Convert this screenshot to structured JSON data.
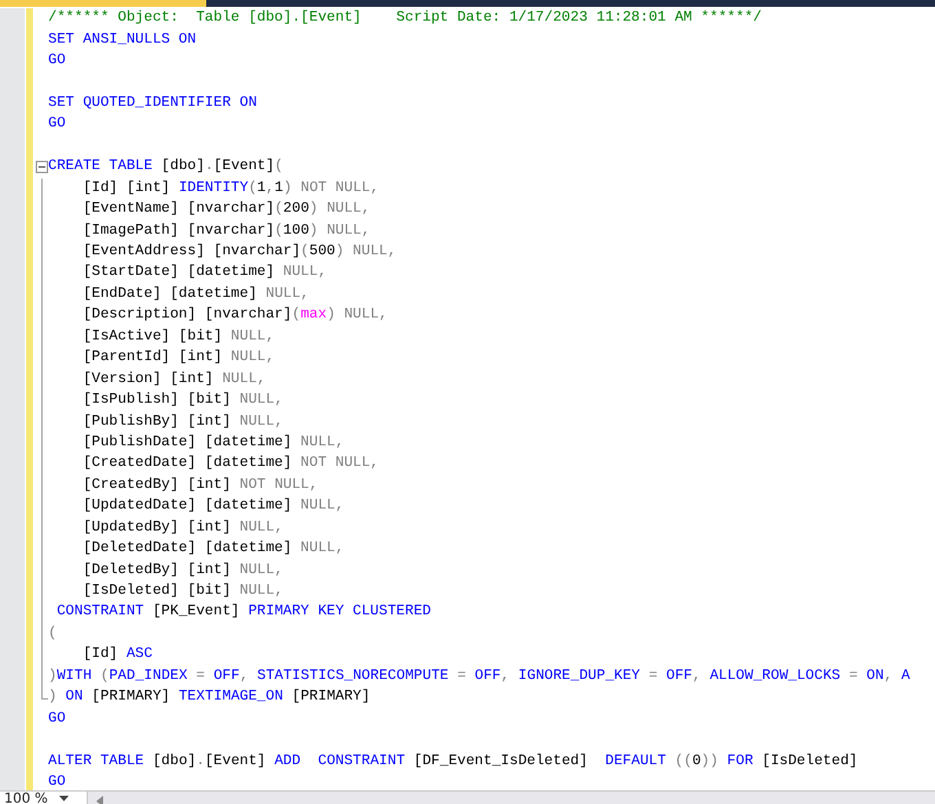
{
  "editor": {
    "lines": [
      {
        "kind": "code",
        "tokens": [
          {
            "kind": "comment",
            "text": "/****** Object:  Table [dbo].[Event]    Script Date: 1/17/2023 11:28:01 AM ******/"
          }
        ]
      },
      {
        "kind": "code",
        "tokens": [
          {
            "kind": "keyword",
            "text": "SET ANSI_NULLS ON"
          }
        ]
      },
      {
        "kind": "code",
        "tokens": [
          {
            "kind": "keyword",
            "text": "GO"
          }
        ]
      },
      {
        "kind": "blank"
      },
      {
        "kind": "code",
        "tokens": [
          {
            "kind": "keyword",
            "text": "SET QUOTED_IDENTIFIER ON"
          }
        ]
      },
      {
        "kind": "code",
        "tokens": [
          {
            "kind": "keyword",
            "text": "GO"
          }
        ]
      },
      {
        "kind": "blank"
      },
      {
        "kind": "code",
        "expanded": true,
        "tokens": [
          {
            "kind": "keyword",
            "text": "CREATE TABLE "
          },
          {
            "kind": "plain",
            "text": "[dbo]"
          },
          {
            "kind": "operator",
            "text": "."
          },
          {
            "kind": "plain",
            "text": "[Event]"
          },
          {
            "kind": "operator",
            "text": "("
          }
        ],
        "children": [
          {
            "kind": "code",
            "tokens": [
              {
                "kind": "plain",
                "text": "    [Id] [int] "
              },
              {
                "kind": "keyword",
                "text": "IDENTITY"
              },
              {
                "kind": "operator",
                "text": "("
              },
              {
                "kind": "plain",
                "text": "1"
              },
              {
                "kind": "operator",
                "text": ","
              },
              {
                "kind": "plain",
                "text": "1"
              },
              {
                "kind": "operator",
                "text": ") NOT NULL,"
              }
            ]
          },
          {
            "kind": "code",
            "tokens": [
              {
                "kind": "plain",
                "text": "    [EventName] [nvarchar]"
              },
              {
                "kind": "operator",
                "text": "("
              },
              {
                "kind": "plain",
                "text": "200"
              },
              {
                "kind": "operator",
                "text": ") NULL,"
              }
            ]
          },
          {
            "kind": "code",
            "tokens": [
              {
                "kind": "plain",
                "text": "    [ImagePath] [nvarchar]"
              },
              {
                "kind": "operator",
                "text": "("
              },
              {
                "kind": "plain",
                "text": "100"
              },
              {
                "kind": "operator",
                "text": ") NULL,"
              }
            ]
          },
          {
            "kind": "code",
            "tokens": [
              {
                "kind": "plain",
                "text": "    [EventAddress] [nvarchar]"
              },
              {
                "kind": "operator",
                "text": "("
              },
              {
                "kind": "plain",
                "text": "500"
              },
              {
                "kind": "operator",
                "text": ") NULL,"
              }
            ]
          },
          {
            "kind": "code",
            "tokens": [
              {
                "kind": "plain",
                "text": "    [StartDate] [datetime] "
              },
              {
                "kind": "operator",
                "text": "NULL,"
              }
            ]
          },
          {
            "kind": "code",
            "tokens": [
              {
                "kind": "plain",
                "text": "    [EndDate] [datetime] "
              },
              {
                "kind": "operator",
                "text": "NULL,"
              }
            ]
          },
          {
            "kind": "code",
            "tokens": [
              {
                "kind": "plain",
                "text": "    [Description] [nvarchar]"
              },
              {
                "kind": "operator",
                "text": "("
              },
              {
                "kind": "function",
                "text": "max"
              },
              {
                "kind": "operator",
                "text": ") NULL,"
              }
            ]
          },
          {
            "kind": "code",
            "tokens": [
              {
                "kind": "plain",
                "text": "    [IsActive] [bit] "
              },
              {
                "kind": "operator",
                "text": "NULL,"
              }
            ]
          },
          {
            "kind": "code",
            "tokens": [
              {
                "kind": "plain",
                "text": "    [ParentId] [int] "
              },
              {
                "kind": "operator",
                "text": "NULL,"
              }
            ]
          },
          {
            "kind": "code",
            "tokens": [
              {
                "kind": "plain",
                "text": "    [Version] [int] "
              },
              {
                "kind": "operator",
                "text": "NULL,"
              }
            ]
          },
          {
            "kind": "code",
            "tokens": [
              {
                "kind": "plain",
                "text": "    [IsPublish] [bit] "
              },
              {
                "kind": "operator",
                "text": "NULL,"
              }
            ]
          },
          {
            "kind": "code",
            "tokens": [
              {
                "kind": "plain",
                "text": "    [PublishBy] [int] "
              },
              {
                "kind": "operator",
                "text": "NULL,"
              }
            ]
          },
          {
            "kind": "code",
            "tokens": [
              {
                "kind": "plain",
                "text": "    [PublishDate] [datetime] "
              },
              {
                "kind": "operator",
                "text": "NULL,"
              }
            ]
          },
          {
            "kind": "code",
            "tokens": [
              {
                "kind": "plain",
                "text": "    [CreatedDate] [datetime] "
              },
              {
                "kind": "operator",
                "text": "NOT NULL,"
              }
            ]
          },
          {
            "kind": "code",
            "tokens": [
              {
                "kind": "plain",
                "text": "    [CreatedBy] [int] "
              },
              {
                "kind": "operator",
                "text": "NOT NULL,"
              }
            ]
          },
          {
            "kind": "code",
            "tokens": [
              {
                "kind": "plain",
                "text": "    [UpdatedDate] [datetime] "
              },
              {
                "kind": "operator",
                "text": "NULL,"
              }
            ]
          },
          {
            "kind": "code",
            "tokens": [
              {
                "kind": "plain",
                "text": "    [UpdatedBy] [int] "
              },
              {
                "kind": "operator",
                "text": "NULL,"
              }
            ]
          },
          {
            "kind": "code",
            "tokens": [
              {
                "kind": "plain",
                "text": "    [DeletedDate] [datetime] "
              },
              {
                "kind": "operator",
                "text": "NULL,"
              }
            ]
          },
          {
            "kind": "code",
            "tokens": [
              {
                "kind": "plain",
                "text": "    [DeletedBy] [int] "
              },
              {
                "kind": "operator",
                "text": "NULL,"
              }
            ]
          },
          {
            "kind": "code",
            "tokens": [
              {
                "kind": "plain",
                "text": "    [IsDeleted] [bit] "
              },
              {
                "kind": "operator",
                "text": "NULL,"
              }
            ]
          },
          {
            "kind": "code",
            "tokens": [
              {
                "kind": "keyword",
                "text": " CONSTRAINT "
              },
              {
                "kind": "plain",
                "text": "[PK_Event] "
              },
              {
                "kind": "keyword",
                "text": "PRIMARY KEY CLUSTERED"
              }
            ]
          },
          {
            "kind": "code",
            "tokens": [
              {
                "kind": "operator",
                "text": "("
              }
            ]
          },
          {
            "kind": "code",
            "tokens": [
              {
                "kind": "plain",
                "text": "    [Id] "
              },
              {
                "kind": "keyword",
                "text": "ASC"
              }
            ]
          },
          {
            "kind": "code",
            "tokens": [
              {
                "kind": "operator",
                "text": ")"
              },
              {
                "kind": "keyword",
                "text": "WITH "
              },
              {
                "kind": "operator",
                "text": "("
              },
              {
                "kind": "keyword",
                "text": "PAD_INDEX "
              },
              {
                "kind": "operator",
                "text": "= "
              },
              {
                "kind": "keyword",
                "text": "OFF"
              },
              {
                "kind": "operator",
                "text": ", "
              },
              {
                "kind": "keyword",
                "text": "STATISTICS_NORECOMPUTE "
              },
              {
                "kind": "operator",
                "text": "= "
              },
              {
                "kind": "keyword",
                "text": "OFF"
              },
              {
                "kind": "operator",
                "text": ", "
              },
              {
                "kind": "keyword",
                "text": "IGNORE_DUP_KEY "
              },
              {
                "kind": "operator",
                "text": "= "
              },
              {
                "kind": "keyword",
                "text": "OFF"
              },
              {
                "kind": "operator",
                "text": ", "
              },
              {
                "kind": "keyword",
                "text": "ALLOW_ROW_LOCKS "
              },
              {
                "kind": "operator",
                "text": "= "
              },
              {
                "kind": "keyword",
                "text": "ON"
              },
              {
                "kind": "operator",
                "text": ", "
              },
              {
                "kind": "keyword",
                "text": "A"
              }
            ]
          },
          {
            "kind": "code",
            "tokens": [
              {
                "kind": "operator",
                "text": ") "
              },
              {
                "kind": "keyword",
                "text": "ON "
              },
              {
                "kind": "plain",
                "text": "[PRIMARY] "
              },
              {
                "kind": "keyword",
                "text": "TEXTIMAGE_ON "
              },
              {
                "kind": "plain",
                "text": "[PRIMARY]"
              }
            ]
          }
        ]
      },
      {
        "kind": "code",
        "tokens": [
          {
            "kind": "keyword",
            "text": "GO"
          }
        ]
      },
      {
        "kind": "blank"
      },
      {
        "kind": "code",
        "tokens": [
          {
            "kind": "keyword",
            "text": "ALTER TABLE "
          },
          {
            "kind": "plain",
            "text": "[dbo]"
          },
          {
            "kind": "operator",
            "text": "."
          },
          {
            "kind": "plain",
            "text": "[Event] "
          },
          {
            "kind": "keyword",
            "text": "ADD  CONSTRAINT "
          },
          {
            "kind": "plain",
            "text": "[DF_Event_IsDeleted]  "
          },
          {
            "kind": "keyword",
            "text": "DEFAULT "
          },
          {
            "kind": "operator",
            "text": "(("
          },
          {
            "kind": "plain",
            "text": "0"
          },
          {
            "kind": "operator",
            "text": ")) "
          },
          {
            "kind": "keyword",
            "text": "FOR "
          },
          {
            "kind": "plain",
            "text": "[IsDeleted]"
          }
        ]
      },
      {
        "kind": "code",
        "tokens": [
          {
            "kind": "keyword",
            "text": "GO"
          }
        ]
      }
    ]
  },
  "status_bar": {
    "zoom": "100 %"
  }
}
